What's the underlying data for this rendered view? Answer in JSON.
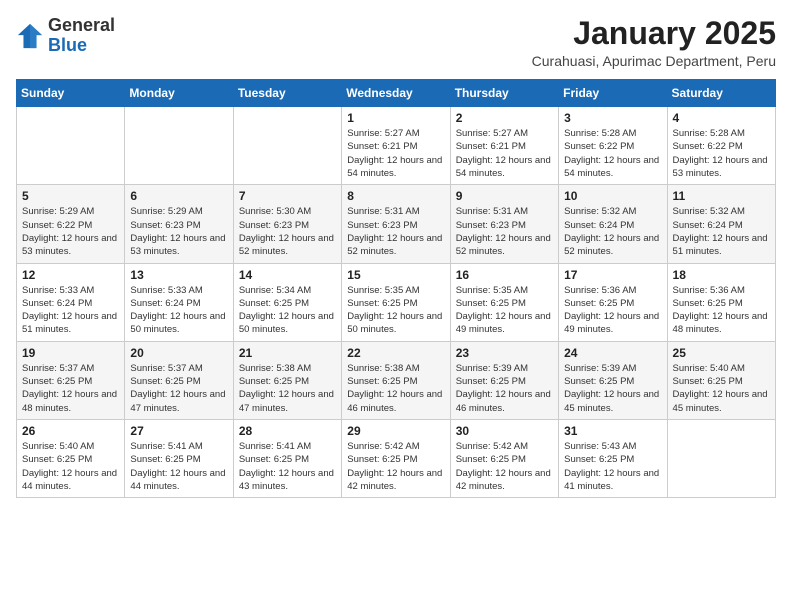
{
  "logo": {
    "general": "General",
    "blue": "Blue"
  },
  "title": "January 2025",
  "subtitle": "Curahuasi, Apurimac Department, Peru",
  "days_of_week": [
    "Sunday",
    "Monday",
    "Tuesday",
    "Wednesday",
    "Thursday",
    "Friday",
    "Saturday"
  ],
  "weeks": [
    [
      {
        "day": "",
        "info": ""
      },
      {
        "day": "",
        "info": ""
      },
      {
        "day": "",
        "info": ""
      },
      {
        "day": "1",
        "info": "Sunrise: 5:27 AM\nSunset: 6:21 PM\nDaylight: 12 hours\nand 54 minutes."
      },
      {
        "day": "2",
        "info": "Sunrise: 5:27 AM\nSunset: 6:21 PM\nDaylight: 12 hours\nand 54 minutes."
      },
      {
        "day": "3",
        "info": "Sunrise: 5:28 AM\nSunset: 6:22 PM\nDaylight: 12 hours\nand 54 minutes."
      },
      {
        "day": "4",
        "info": "Sunrise: 5:28 AM\nSunset: 6:22 PM\nDaylight: 12 hours\nand 53 minutes."
      }
    ],
    [
      {
        "day": "5",
        "info": "Sunrise: 5:29 AM\nSunset: 6:22 PM\nDaylight: 12 hours\nand 53 minutes."
      },
      {
        "day": "6",
        "info": "Sunrise: 5:29 AM\nSunset: 6:23 PM\nDaylight: 12 hours\nand 53 minutes."
      },
      {
        "day": "7",
        "info": "Sunrise: 5:30 AM\nSunset: 6:23 PM\nDaylight: 12 hours\nand 52 minutes."
      },
      {
        "day": "8",
        "info": "Sunrise: 5:31 AM\nSunset: 6:23 PM\nDaylight: 12 hours\nand 52 minutes."
      },
      {
        "day": "9",
        "info": "Sunrise: 5:31 AM\nSunset: 6:23 PM\nDaylight: 12 hours\nand 52 minutes."
      },
      {
        "day": "10",
        "info": "Sunrise: 5:32 AM\nSunset: 6:24 PM\nDaylight: 12 hours\nand 52 minutes."
      },
      {
        "day": "11",
        "info": "Sunrise: 5:32 AM\nSunset: 6:24 PM\nDaylight: 12 hours\nand 51 minutes."
      }
    ],
    [
      {
        "day": "12",
        "info": "Sunrise: 5:33 AM\nSunset: 6:24 PM\nDaylight: 12 hours\nand 51 minutes."
      },
      {
        "day": "13",
        "info": "Sunrise: 5:33 AM\nSunset: 6:24 PM\nDaylight: 12 hours\nand 50 minutes."
      },
      {
        "day": "14",
        "info": "Sunrise: 5:34 AM\nSunset: 6:25 PM\nDaylight: 12 hours\nand 50 minutes."
      },
      {
        "day": "15",
        "info": "Sunrise: 5:35 AM\nSunset: 6:25 PM\nDaylight: 12 hours\nand 50 minutes."
      },
      {
        "day": "16",
        "info": "Sunrise: 5:35 AM\nSunset: 6:25 PM\nDaylight: 12 hours\nand 49 minutes."
      },
      {
        "day": "17",
        "info": "Sunrise: 5:36 AM\nSunset: 6:25 PM\nDaylight: 12 hours\nand 49 minutes."
      },
      {
        "day": "18",
        "info": "Sunrise: 5:36 AM\nSunset: 6:25 PM\nDaylight: 12 hours\nand 48 minutes."
      }
    ],
    [
      {
        "day": "19",
        "info": "Sunrise: 5:37 AM\nSunset: 6:25 PM\nDaylight: 12 hours\nand 48 minutes."
      },
      {
        "day": "20",
        "info": "Sunrise: 5:37 AM\nSunset: 6:25 PM\nDaylight: 12 hours\nand 47 minutes."
      },
      {
        "day": "21",
        "info": "Sunrise: 5:38 AM\nSunset: 6:25 PM\nDaylight: 12 hours\nand 47 minutes."
      },
      {
        "day": "22",
        "info": "Sunrise: 5:38 AM\nSunset: 6:25 PM\nDaylight: 12 hours\nand 46 minutes."
      },
      {
        "day": "23",
        "info": "Sunrise: 5:39 AM\nSunset: 6:25 PM\nDaylight: 12 hours\nand 46 minutes."
      },
      {
        "day": "24",
        "info": "Sunrise: 5:39 AM\nSunset: 6:25 PM\nDaylight: 12 hours\nand 45 minutes."
      },
      {
        "day": "25",
        "info": "Sunrise: 5:40 AM\nSunset: 6:25 PM\nDaylight: 12 hours\nand 45 minutes."
      }
    ],
    [
      {
        "day": "26",
        "info": "Sunrise: 5:40 AM\nSunset: 6:25 PM\nDaylight: 12 hours\nand 44 minutes."
      },
      {
        "day": "27",
        "info": "Sunrise: 5:41 AM\nSunset: 6:25 PM\nDaylight: 12 hours\nand 44 minutes."
      },
      {
        "day": "28",
        "info": "Sunrise: 5:41 AM\nSunset: 6:25 PM\nDaylight: 12 hours\nand 43 minutes."
      },
      {
        "day": "29",
        "info": "Sunrise: 5:42 AM\nSunset: 6:25 PM\nDaylight: 12 hours\nand 42 minutes."
      },
      {
        "day": "30",
        "info": "Sunrise: 5:42 AM\nSunset: 6:25 PM\nDaylight: 12 hours\nand 42 minutes."
      },
      {
        "day": "31",
        "info": "Sunrise: 5:43 AM\nSunset: 6:25 PM\nDaylight: 12 hours\nand 41 minutes."
      },
      {
        "day": "",
        "info": ""
      }
    ]
  ]
}
